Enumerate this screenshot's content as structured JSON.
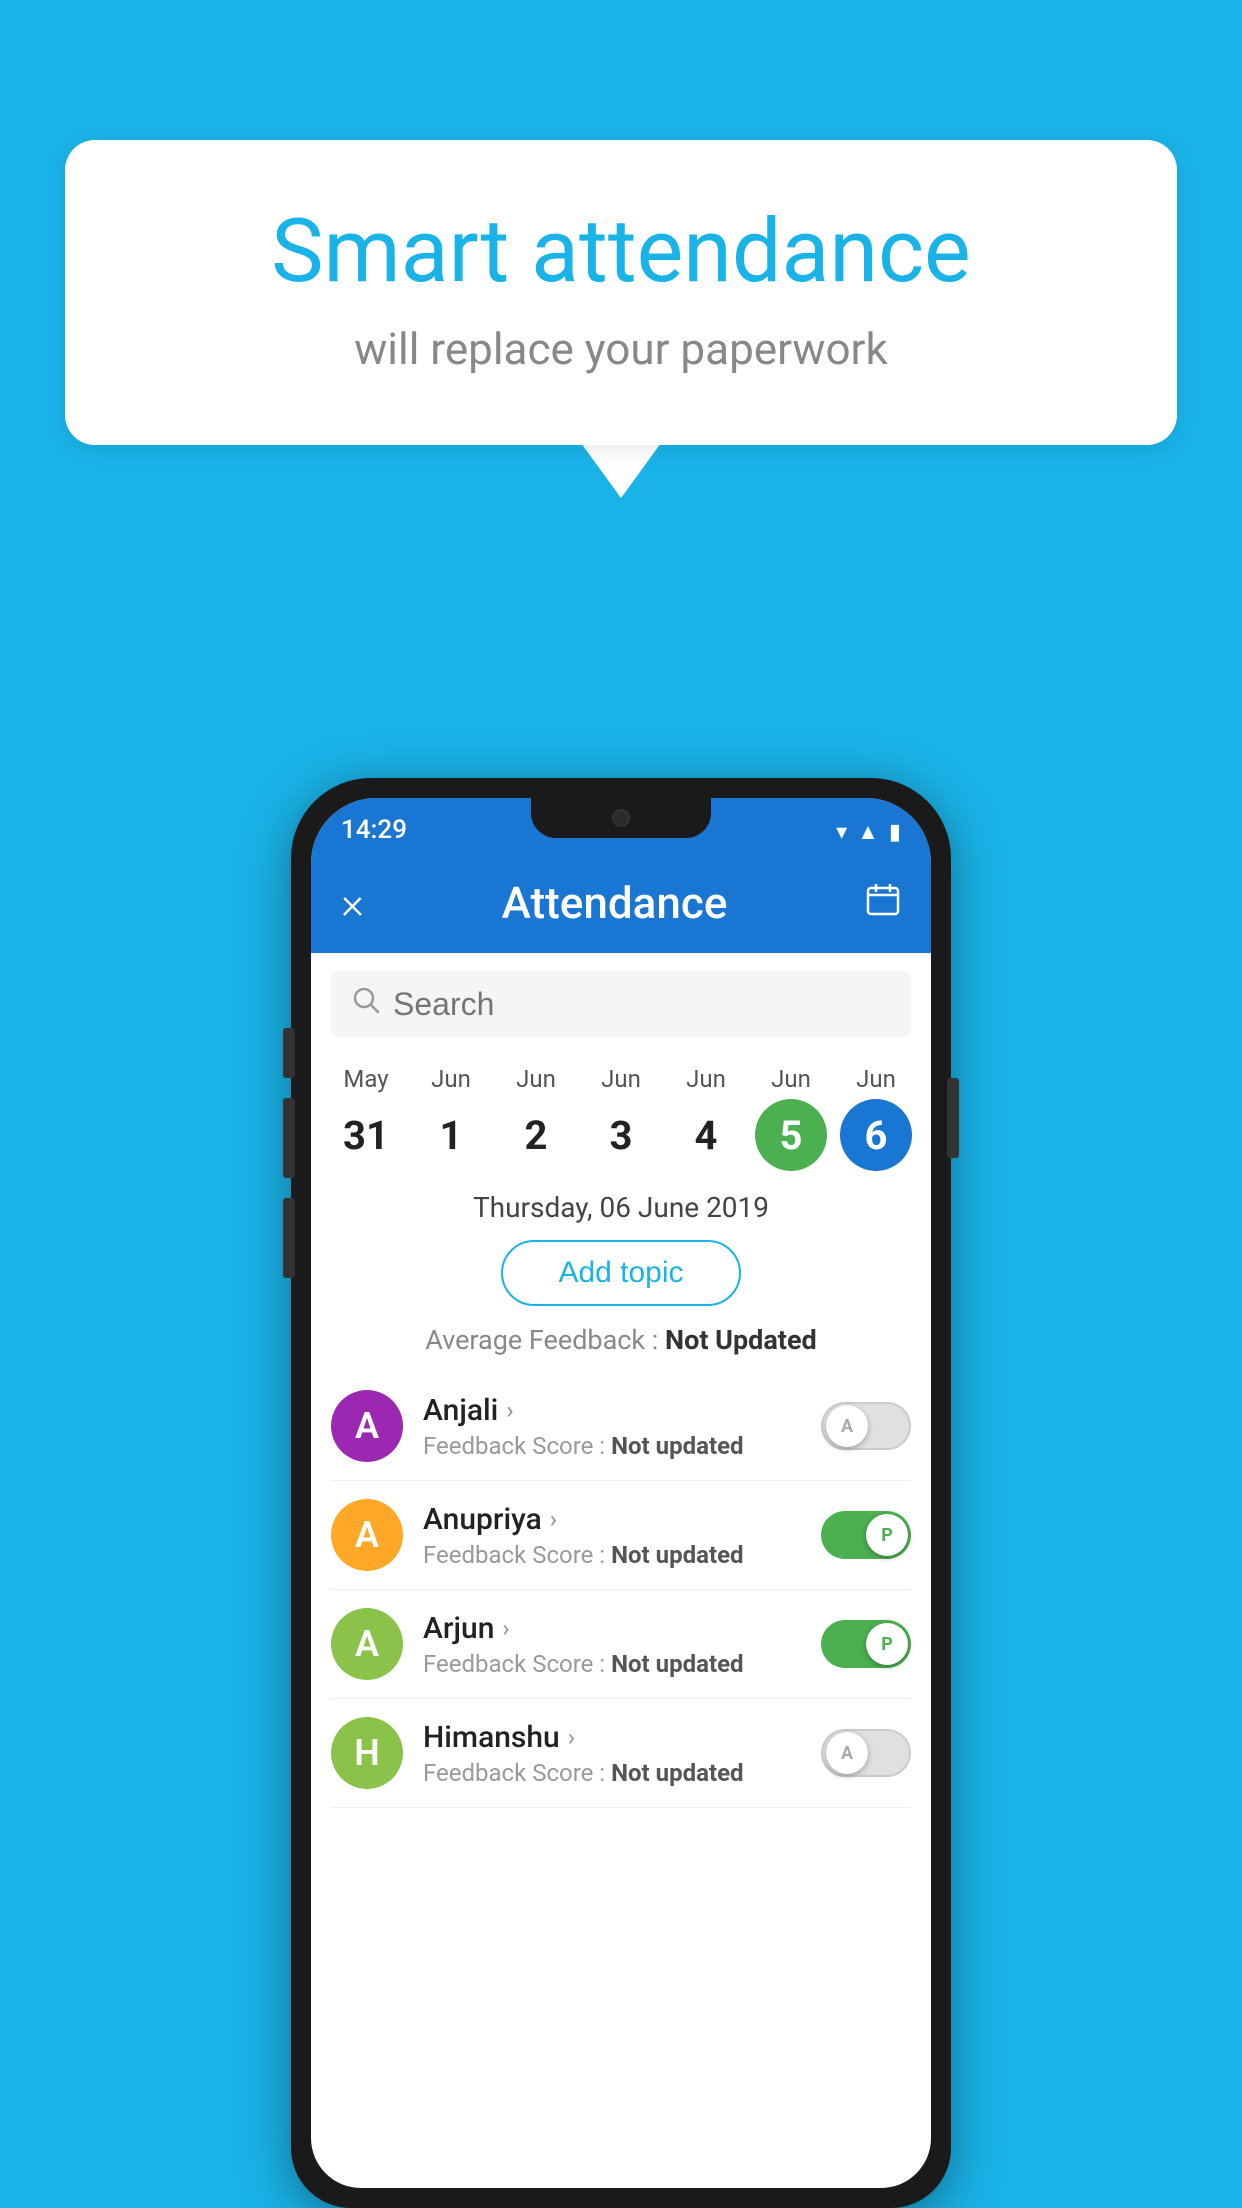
{
  "background_color": "#1ab3e8",
  "speech_bubble": {
    "title": "Smart attendance",
    "subtitle": "will replace your paperwork"
  },
  "status_bar": {
    "time": "14:29",
    "icons": [
      "wifi",
      "signal",
      "battery"
    ]
  },
  "app_bar": {
    "close_label": "×",
    "title": "Attendance",
    "calendar_icon": "📅"
  },
  "search": {
    "placeholder": "Search"
  },
  "calendar": {
    "days": [
      {
        "month": "May",
        "day": "31",
        "state": "normal"
      },
      {
        "month": "Jun",
        "day": "1",
        "state": "normal"
      },
      {
        "month": "Jun",
        "day": "2",
        "state": "normal"
      },
      {
        "month": "Jun",
        "day": "3",
        "state": "normal"
      },
      {
        "month": "Jun",
        "day": "4",
        "state": "normal"
      },
      {
        "month": "Jun",
        "day": "5",
        "state": "today"
      },
      {
        "month": "Jun",
        "day": "6",
        "state": "selected"
      }
    ]
  },
  "selected_date": "Thursday, 06 June 2019",
  "add_topic_label": "Add topic",
  "avg_feedback": {
    "label": "Average Feedback : ",
    "value": "Not Updated"
  },
  "students": [
    {
      "name": "Anjali",
      "avatar_letter": "A",
      "avatar_color": "#9c27b0",
      "feedback_label": "Feedback Score : ",
      "feedback_value": "Not updated",
      "toggle_state": "off",
      "toggle_label": "A"
    },
    {
      "name": "Anupriya",
      "avatar_letter": "A",
      "avatar_color": "#ffa726",
      "feedback_label": "Feedback Score : ",
      "feedback_value": "Not updated",
      "toggle_state": "on",
      "toggle_label": "P"
    },
    {
      "name": "Arjun",
      "avatar_letter": "A",
      "avatar_color": "#8bc34a",
      "feedback_label": "Feedback Score : ",
      "feedback_value": "Not updated",
      "toggle_state": "on",
      "toggle_label": "P"
    },
    {
      "name": "Himanshu",
      "avatar_letter": "H",
      "avatar_color": "#8bc34a",
      "feedback_label": "Feedback Score : ",
      "feedback_value": "Not updated",
      "toggle_state": "off",
      "toggle_label": "A"
    }
  ]
}
